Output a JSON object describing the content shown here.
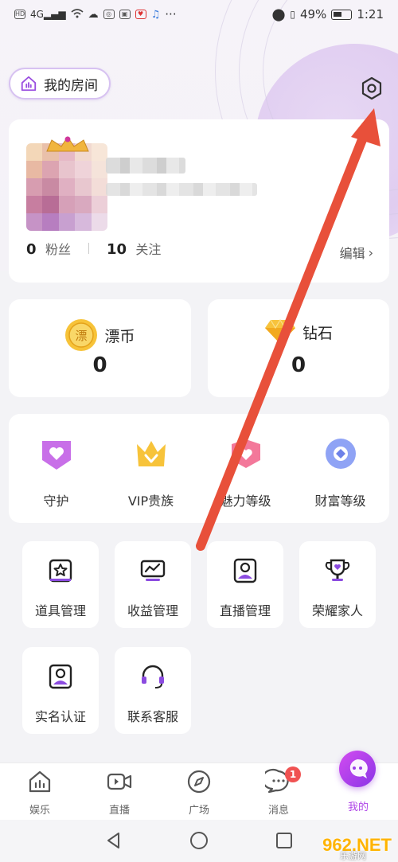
{
  "status_bar": {
    "left_icons": [
      "HD",
      "4G",
      "wifi-icon",
      "cloud-icon",
      "app-icon",
      "app-icon",
      "app-icon",
      "music-icon",
      "..."
    ],
    "battery_percent": "49%",
    "time": "1:21"
  },
  "header": {
    "room_label": "我的房间",
    "settings_icon": "gear-icon"
  },
  "profile": {
    "fans_count": "0",
    "fans_label": "粉丝",
    "follow_count": "10",
    "follow_label": "关注",
    "edit_label": "编辑"
  },
  "wallet": {
    "coin_label": "漂币",
    "coin_icon_text": "漂",
    "coin_value": "0",
    "diamond_label": "钻石",
    "diamond_value": "0"
  },
  "levels": [
    {
      "label": "守护",
      "icon": "shield-heart-icon"
    },
    {
      "label": "VIP贵族",
      "icon": "crown-icon"
    },
    {
      "label": "魅力等级",
      "icon": "charm-heart-icon"
    },
    {
      "label": "财富等级",
      "icon": "wealth-coin-icon"
    }
  ],
  "tools": [
    {
      "label": "道具管理",
      "icon": "star-box-icon"
    },
    {
      "label": "收益管理",
      "icon": "monitor-chart-icon"
    },
    {
      "label": "直播管理",
      "icon": "portrait-icon"
    },
    {
      "label": "荣耀家人",
      "icon": "trophy-icon"
    },
    {
      "label": "实名认证",
      "icon": "id-card-icon"
    },
    {
      "label": "联系客服",
      "icon": "headset-icon"
    }
  ],
  "bottom_nav": [
    {
      "label": "娱乐",
      "icon": "chart-bars-icon"
    },
    {
      "label": "直播",
      "icon": "video-icon"
    },
    {
      "label": "广场",
      "icon": "compass-icon"
    },
    {
      "label": "消息",
      "icon": "chat-icon",
      "badge": "1"
    },
    {
      "label": "我的",
      "icon": "profile-bubble-icon",
      "active": true
    }
  ],
  "watermark": "962.NET",
  "watermark_sub": "乐游网",
  "colors": {
    "accent": "#b046e8",
    "arrow": "#e8503a",
    "badge": "#f05252"
  }
}
